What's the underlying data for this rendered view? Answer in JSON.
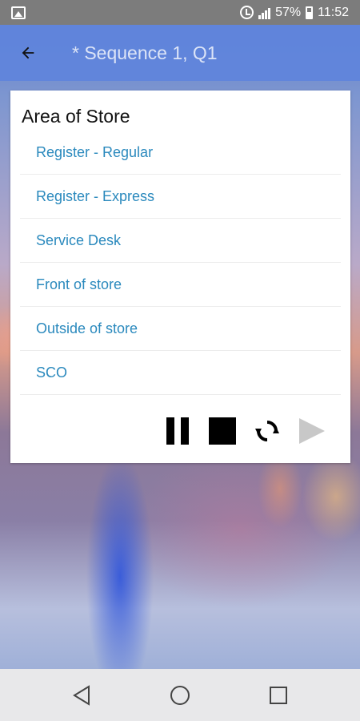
{
  "status_bar": {
    "battery": "57%",
    "time": "11:52"
  },
  "app_bar": {
    "title": "* Sequence 1, Q1"
  },
  "question": {
    "title": "Area of Store",
    "options": [
      "Register - Regular",
      "Register - Express",
      "Service Desk",
      "Front of store",
      "Outside of store",
      "SCO"
    ]
  },
  "controls": {
    "play_enabled": false
  },
  "icons": {
    "status": [
      "gallery-icon",
      "alarm-icon",
      "signal-icon",
      "battery-icon"
    ],
    "app_bar": "arrow-left-icon",
    "controls": [
      "pause-icon",
      "stop-icon",
      "refresh-icon",
      "play-icon"
    ],
    "nav": [
      "back-triangle-icon",
      "home-circle-icon",
      "recents-square-icon"
    ]
  },
  "colors": {
    "app_bar": "#6084dc",
    "option_text": "#2a89bd",
    "status_bar": "#7c7c7c",
    "nav_bar": "#e8e8ea"
  }
}
